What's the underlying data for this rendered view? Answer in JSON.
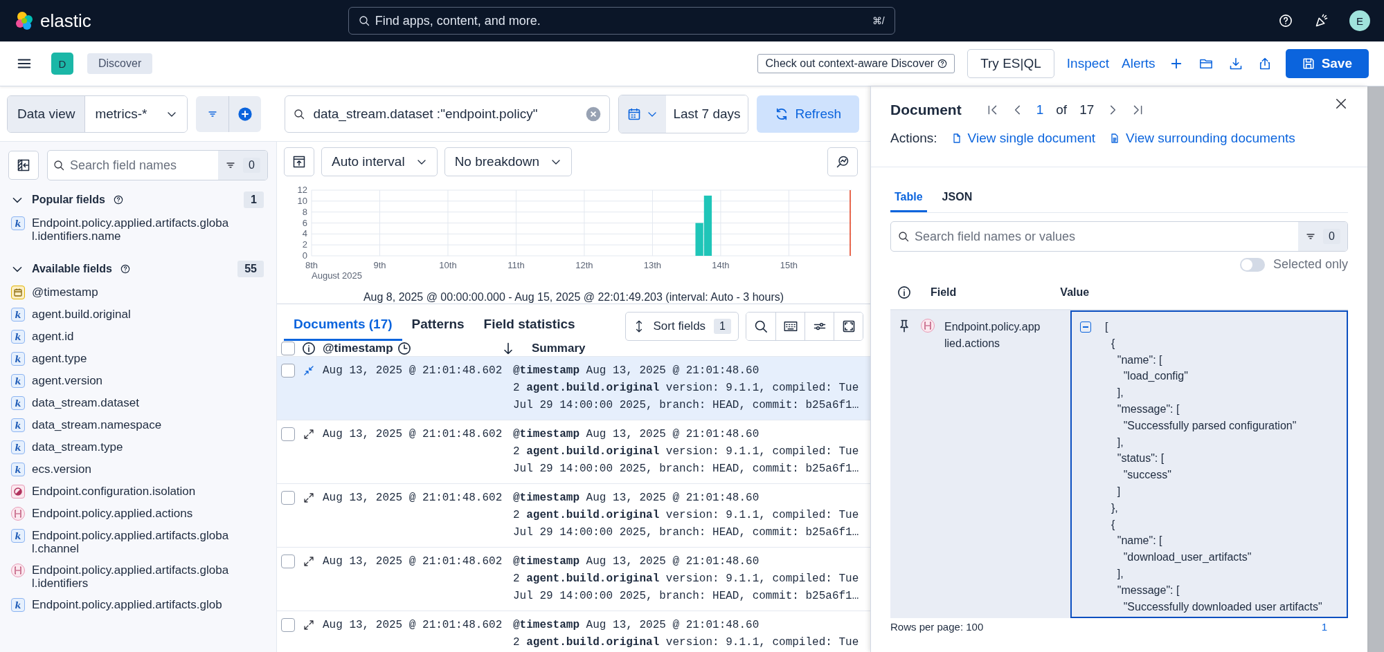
{
  "header": {
    "brand": "elastic",
    "search": {
      "placeholder": "Find apps, content, and more.",
      "shortcut": "⌘/"
    },
    "avatar": "E"
  },
  "nav": {
    "space": "D",
    "breadcrumb": "Discover",
    "promo": "Check out context-aware Discover",
    "esql": "Try ES|QL",
    "links": [
      "Inspect",
      "Alerts"
    ],
    "save": "Save"
  },
  "query": {
    "data_view_label": "Data view",
    "data_view": "metrics-*",
    "value": "data_stream.dataset :\"endpoint.policy\"",
    "time": "Last 7 days",
    "refresh": "Refresh"
  },
  "sidebar": {
    "search": {
      "placeholder": "Search field names"
    },
    "filter_count": "0",
    "sections": [
      {
        "title": "Popular fields",
        "count": "1",
        "fields": [
          {
            "kind": "keyword",
            "icon": "k",
            "name": "Endpoint.policy.applied.artifacts.global.identifiers.name"
          }
        ]
      },
      {
        "title": "Available fields",
        "count": "55",
        "fields": [
          {
            "kind": "date",
            "name": "@timestamp"
          },
          {
            "kind": "keyword",
            "icon": "k",
            "name": "agent.build.original"
          },
          {
            "kind": "keyword",
            "icon": "k",
            "name": "agent.id"
          },
          {
            "kind": "keyword",
            "icon": "k",
            "name": "agent.type"
          },
          {
            "kind": "keyword",
            "icon": "k",
            "name": "agent.version"
          },
          {
            "kind": "keyword",
            "icon": "k",
            "name": "data_stream.dataset"
          },
          {
            "kind": "keyword",
            "icon": "k",
            "name": "data_stream.namespace"
          },
          {
            "kind": "keyword",
            "icon": "k",
            "name": "data_stream.type"
          },
          {
            "kind": "keyword",
            "icon": "k",
            "name": "ecs.version"
          },
          {
            "kind": "boolean",
            "name": "Endpoint.configuration.isolation"
          },
          {
            "kind": "object",
            "name": "Endpoint.policy.applied.actions"
          },
          {
            "kind": "keyword",
            "icon": "k",
            "name": "Endpoint.policy.applied.artifacts.global.channel"
          },
          {
            "kind": "object",
            "name": "Endpoint.policy.applied.artifacts.global.identifiers"
          },
          {
            "kind": "keyword",
            "icon": "k",
            "name": "Endpoint.policy.applied.artifacts.glob"
          }
        ]
      }
    ]
  },
  "histogram": {
    "interval": "Auto interval",
    "breakdown": "No breakdown",
    "caption": "Aug 8, 2025 @ 00:00:00.000 - Aug 15, 2025 @ 22:01:49.203 (interval: Auto - 3 hours)",
    "chart_data": {
      "type": "bar",
      "x": [
        13.6875,
        13.8125
      ],
      "values": [
        6,
        11
      ],
      "xlim": [
        8,
        15.92
      ],
      "ylim": [
        0,
        12
      ],
      "yticks": [
        0,
        2,
        4,
        6,
        8,
        10,
        12
      ],
      "grid": true,
      "xticks": [
        {
          "value": 8,
          "label": "8th"
        },
        {
          "value": 9,
          "label": "9th"
        },
        {
          "value": 10,
          "label": "10th"
        },
        {
          "value": 11,
          "label": "11th"
        },
        {
          "value": 12,
          "label": "12th"
        },
        {
          "value": 13,
          "label": "13th"
        },
        {
          "value": 14,
          "label": "14th"
        },
        {
          "value": 15,
          "label": "15th"
        }
      ],
      "ref_lines": [
        {
          "axis": "x",
          "value": 15.9,
          "color": "#e7664c"
        }
      ],
      "annotations": [
        "August 2025"
      ]
    }
  },
  "documents": {
    "tabs": [
      {
        "label": "Documents (17)",
        "selected": true
      },
      {
        "label": "Patterns",
        "selected": false
      },
      {
        "label": "Field statistics",
        "selected": false
      }
    ],
    "sort_label": "Sort fields",
    "sort_count": "1",
    "select_all": {
      "checked": false
    },
    "columns": [
      "@timestamp",
      "Summary"
    ],
    "rows": [
      {
        "checked": false,
        "selected": true,
        "timestamp": "Aug 13, 2025 @ 21:01:48.602",
        "summary": [
          "**@timestamp** Aug 13, 2025 @ 21:01:48.60",
          "2 **agent.build.original** version: 9.1.1, compiled: Tue",
          "Jul 29 14:00:00 2025, branch: HEAD, commit: b25a6f1…"
        ]
      },
      {
        "checked": false,
        "selected": false,
        "timestamp": "Aug 13, 2025 @ 21:01:48.602",
        "summary": [
          "**@timestamp** Aug 13, 2025 @ 21:01:48.60",
          "2 **agent.build.original** version: 9.1.1, compiled: Tue",
          "Jul 29 14:00:00 2025, branch: HEAD, commit: b25a6f1…"
        ]
      },
      {
        "checked": false,
        "selected": false,
        "timestamp": "Aug 13, 2025 @ 21:01:48.602",
        "summary": [
          "**@timestamp** Aug 13, 2025 @ 21:01:48.60",
          "2 **agent.build.original** version: 9.1.1, compiled: Tue",
          "Jul 29 14:00:00 2025, branch: HEAD, commit: b25a6f1…"
        ]
      },
      {
        "checked": false,
        "selected": false,
        "timestamp": "Aug 13, 2025 @ 21:01:48.602",
        "summary": [
          "**@timestamp** Aug 13, 2025 @ 21:01:48.60",
          "2 **agent.build.original** version: 9.1.1, compiled: Tue",
          "Jul 29 14:00:00 2025, branch: HEAD, commit: b25a6f1…"
        ]
      },
      {
        "checked": false,
        "selected": false,
        "timestamp": "Aug 13, 2025 @ 21:01:48.602",
        "summary": [
          "**@timestamp** Aug 13, 2025 @ 21:01:48.60",
          "2 **agent.build.original** version: 9.1.1, compiled: Tue"
        ]
      }
    ]
  },
  "flyout": {
    "title": "Document",
    "page": "1",
    "of": "of",
    "total": "17",
    "actions_label": "Actions:",
    "actions": [
      "View single document",
      "View surrounding documents"
    ],
    "tabs": [
      {
        "label": "Table",
        "selected": true
      },
      {
        "label": "JSON",
        "selected": false
      }
    ],
    "search": {
      "placeholder": "Search field names or values"
    },
    "filter_count": "0",
    "selected_only": {
      "label": "Selected only",
      "on": false
    },
    "columns": [
      "Field",
      "Value"
    ],
    "row": {
      "kind": "object",
      "field": "Endpoint.policy.applied.actions",
      "value": [
        "[",
        "  {",
        "    \"name\": [",
        "      \"load_config\"",
        "    ],",
        "    \"message\": [",
        "      \"Successfully parsed configuration\"",
        "    ],",
        "    \"status\": [",
        "      \"success\"",
        "    ]",
        "  },",
        "  {",
        "    \"name\": [",
        "      \"download_user_artifacts\"",
        "    ],",
        "    \"message\": [",
        "      \"Successfully downloaded user artifacts\""
      ]
    },
    "rows_per_page": "Rows per page: 100",
    "current_page": "1"
  }
}
